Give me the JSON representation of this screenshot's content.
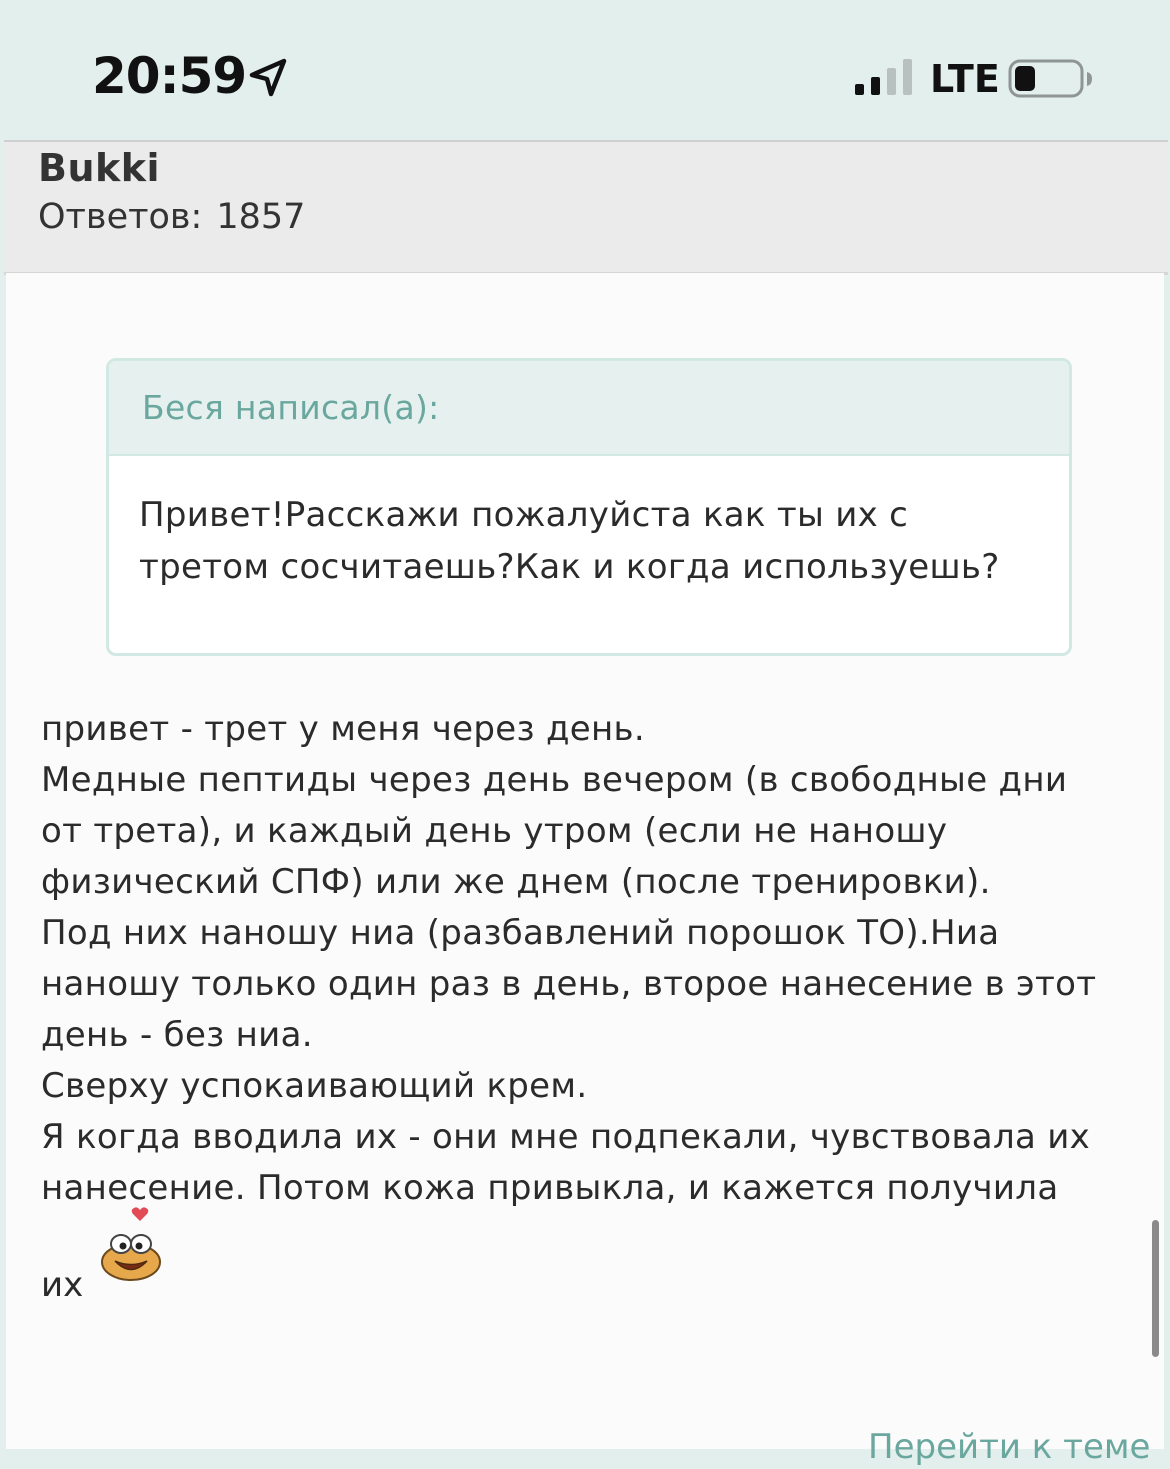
{
  "status_bar": {
    "time": "20:59",
    "network": "LTE",
    "icons": [
      "location-arrow-icon",
      "signal-bars-icon",
      "battery-low-icon"
    ]
  },
  "post": {
    "author": "Bukki",
    "replies_label": "Ответов:",
    "replies_count": "1857"
  },
  "quote": {
    "author_line": "Беся написал(а):",
    "lines": [
      "Привет!Расскажи пожалуйста как ты их с",
      "третом сосчитаешь?Как и когда используешь?"
    ]
  },
  "reply": {
    "lines": [
      "привет - трет у меня через день.",
      "Медные пептиды через день вечером (в свободные дни",
      "от трета), и каждый день утром (если не наношу",
      "физический СПФ) или же днем (после тренировки).",
      "Под них наношу ниа (разбавлений порошок ТО).Ниа",
      "наношу только один раз в день, второе нанесение в этот",
      "день - без ниа.",
      "Сверху успокаивающий крем.",
      "Я когда вводила их - они мне подпекали, чувствовала их",
      "нанесение. Потом кожа привыкла, и кажется получила"
    ],
    "last_word": "их",
    "emoji": "smiley-heart-icon"
  },
  "footer": {
    "goto_link": "Перейти к теме"
  },
  "colors": {
    "status_bg": "#e3efec",
    "quote_accent": "#6aa79e",
    "quote_border": "#d2e8e3",
    "header_bg": "#ebebeb",
    "body_bg": "#fbfbfb"
  }
}
